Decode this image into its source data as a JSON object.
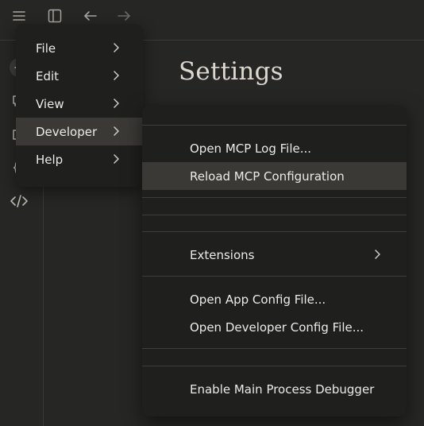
{
  "header": {
    "icons": [
      "menu-icon",
      "sidebar-toggle-icon",
      "back-arrow-icon",
      "forward-arrow-icon"
    ]
  },
  "sidebar": {
    "icons": [
      "new-chat-icon",
      "chat-bubble-icon",
      "folder-icon",
      "braces-icon",
      "code-icon"
    ]
  },
  "main": {
    "title": "Settings"
  },
  "menu": {
    "items": [
      {
        "label": "File"
      },
      {
        "label": "Edit"
      },
      {
        "label": "View"
      },
      {
        "label": "Developer"
      },
      {
        "label": "Help"
      }
    ]
  },
  "developer_submenu": {
    "items": [
      {
        "label": "Open MCP Log File..."
      },
      {
        "label": "Reload MCP Configuration"
      },
      {
        "label": "Extensions"
      },
      {
        "label": "Open App Config File..."
      },
      {
        "label": "Open Developer Config File..."
      },
      {
        "label": "Enable Main Process Debugger"
      }
    ]
  },
  "colors": {
    "background": "#262624",
    "menu_background": "#1f1f1d",
    "highlight": "#3a3936",
    "text": "#ecebe6"
  }
}
